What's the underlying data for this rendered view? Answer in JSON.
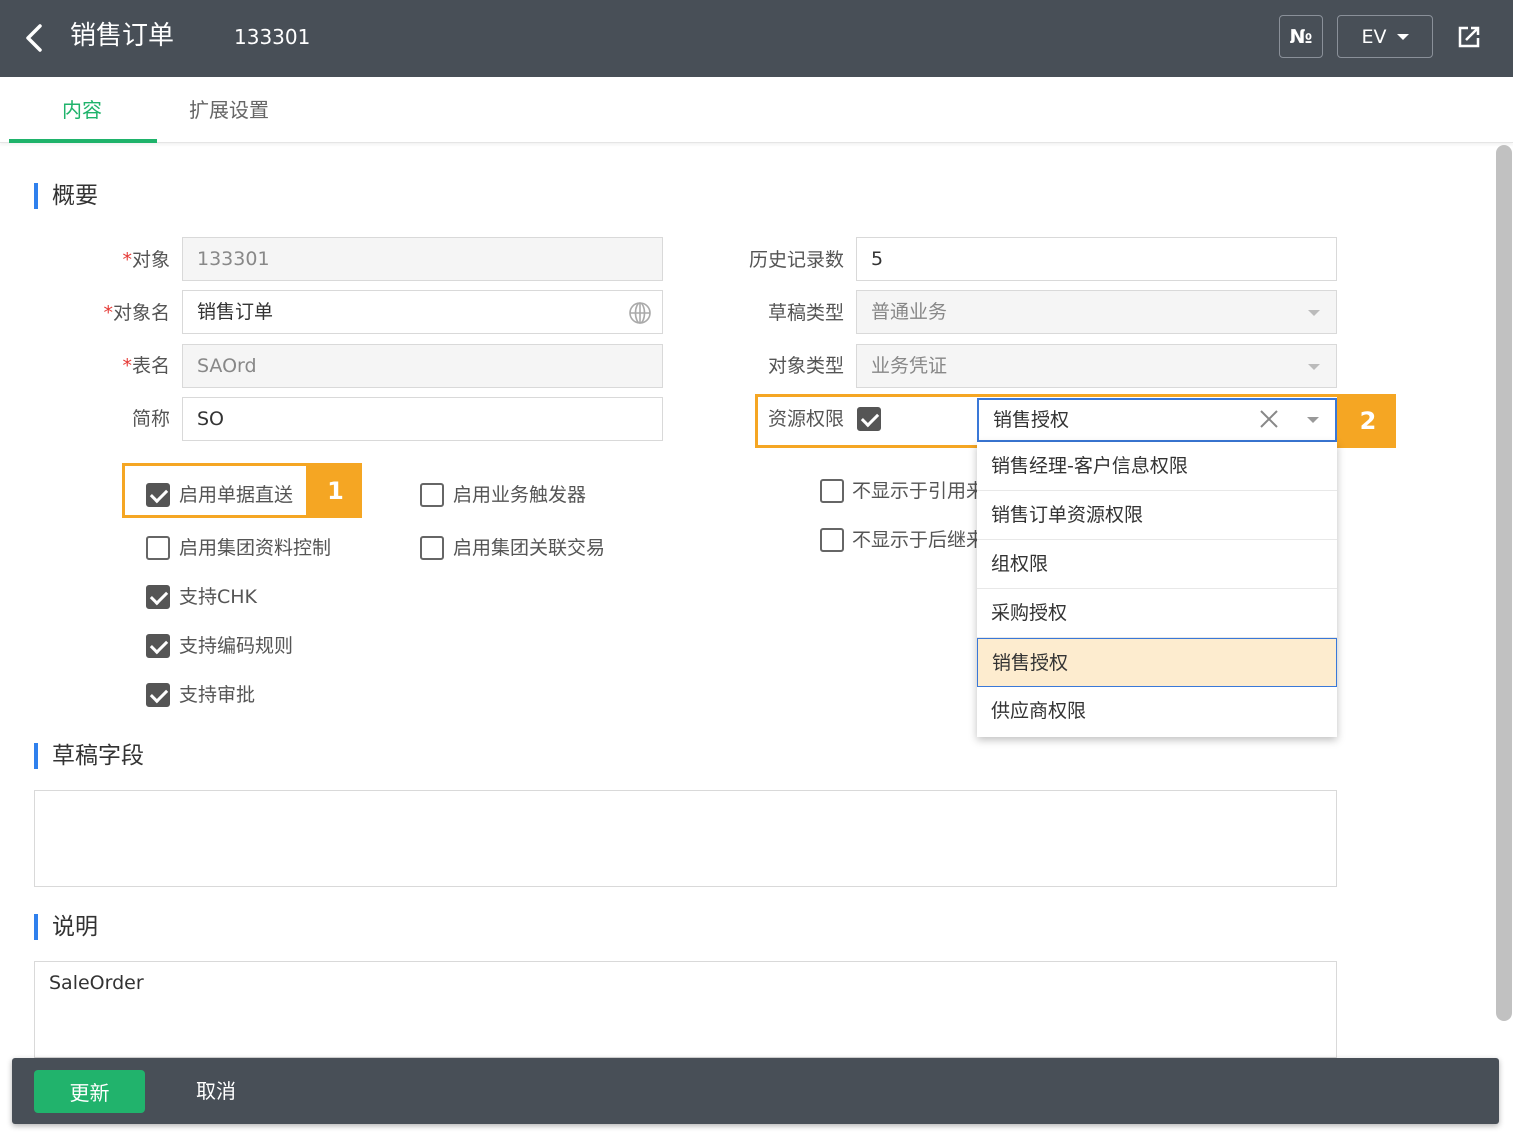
{
  "header": {
    "title": "销售订单",
    "code": "133301",
    "no_button": "№",
    "ev_button": "EV",
    "icons": [
      "chevron-left-icon",
      "export-icon"
    ]
  },
  "tabs": [
    {
      "label": "内容",
      "active": true
    },
    {
      "label": "扩展设置",
      "active": false
    }
  ],
  "sections": {
    "overview": "概要",
    "draft_fields": "草稿字段",
    "description": "说明"
  },
  "left_fields": [
    {
      "label": "对象",
      "required": true,
      "value": "133301",
      "disabled": true
    },
    {
      "label": "对象名",
      "required": true,
      "value": "销售订单",
      "disabled": false,
      "icon": "globe-icon"
    },
    {
      "label": "表名",
      "required": true,
      "value": "SAOrd",
      "disabled": true
    },
    {
      "label": "简称",
      "required": false,
      "value": "SO",
      "disabled": false
    }
  ],
  "right_fields": [
    {
      "label": "历史记录数",
      "value": "5",
      "disabled": false
    },
    {
      "label": "草稿类型",
      "value": "普通业务",
      "disabled": true
    },
    {
      "label": "对象类型",
      "value": "业务凭证",
      "disabled": true
    }
  ],
  "resource_permission": {
    "label": "资源权限",
    "checked": true,
    "value": "销售授权",
    "options": [
      "销售经理-客户信息权限",
      "销售订单资源权限",
      "组权限",
      "采购授权",
      "销售授权",
      "供应商权限"
    ],
    "selected_index": 4
  },
  "checkboxes": {
    "enable_direct_send": {
      "label": "启用单据直送",
      "checked": true
    },
    "enable_business_trigger": {
      "label": "启用业务触发器",
      "checked": false
    },
    "hide_in_reference": {
      "label": "不显示于引用来",
      "checked": false
    },
    "enable_group_data_control": {
      "label": "启用集团资料控制",
      "checked": false
    },
    "enable_group_related_trade": {
      "label": "启用集团关联交易",
      "checked": false
    },
    "hide_in_follow": {
      "label": "不显示于后继来",
      "checked": false
    },
    "support_chk": {
      "label": "支持CHK",
      "checked": true
    },
    "support_code_rule": {
      "label": "支持编码规则",
      "checked": true
    },
    "support_approval": {
      "label": "支持审批",
      "checked": true
    }
  },
  "annotations": {
    "badge1": "1",
    "badge2": "2",
    "color": "#f5a623"
  },
  "draft_fields_value": "",
  "description_value": "SaleOrder",
  "footer": {
    "update": "更新",
    "cancel": "取消"
  },
  "colors": {
    "topbar": "#484f57",
    "accent_green": "#1fb36b",
    "section_bar": "#2f80ed",
    "selected_option": "#fdeccf",
    "focus_border": "#3a78d8"
  }
}
